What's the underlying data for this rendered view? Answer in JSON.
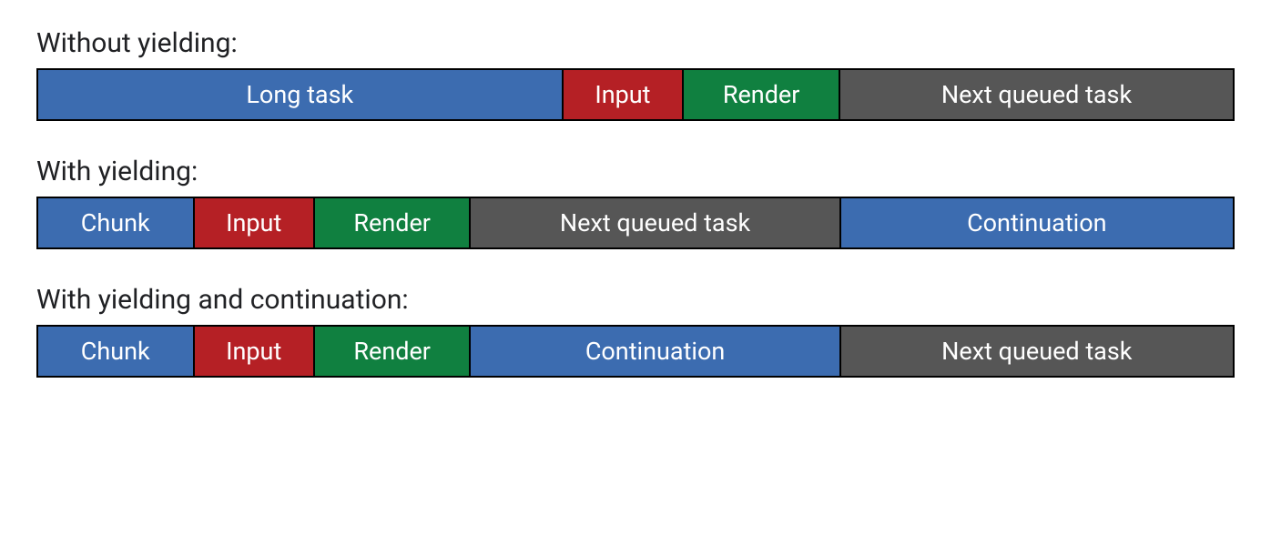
{
  "sections": [
    {
      "title": "Without yielding:",
      "segments": [
        {
          "label": "Long task",
          "color": "blue",
          "flex": 44
        },
        {
          "label": "Input",
          "color": "red",
          "flex": 10
        },
        {
          "label": "Render",
          "color": "green",
          "flex": 13
        },
        {
          "label": "Next queued task",
          "color": "gray",
          "flex": 33
        }
      ]
    },
    {
      "title": "With yielding:",
      "segments": [
        {
          "label": "Chunk",
          "color": "blue",
          "flex": 13
        },
        {
          "label": "Input",
          "color": "red",
          "flex": 10
        },
        {
          "label": "Render",
          "color": "green",
          "flex": 13
        },
        {
          "label": "Next queued task",
          "color": "gray",
          "flex": 31
        },
        {
          "label": "Continuation",
          "color": "blue",
          "flex": 33
        }
      ]
    },
    {
      "title": "With yielding and continuation:",
      "segments": [
        {
          "label": "Chunk",
          "color": "blue",
          "flex": 13
        },
        {
          "label": "Input",
          "color": "red",
          "flex": 10
        },
        {
          "label": "Render",
          "color": "green",
          "flex": 13
        },
        {
          "label": "Continuation",
          "color": "blue",
          "flex": 31
        },
        {
          "label": "Next queued task",
          "color": "gray",
          "flex": 33
        }
      ]
    }
  ]
}
